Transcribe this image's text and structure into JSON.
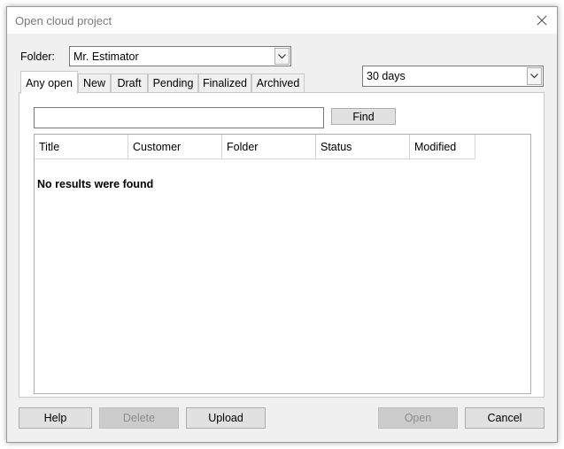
{
  "window": {
    "title": "Open cloud project"
  },
  "folder": {
    "label": "Folder:",
    "value": "Mr. Estimator"
  },
  "period": {
    "value": "30 days"
  },
  "tabs": [
    {
      "label": "Any open"
    },
    {
      "label": "New"
    },
    {
      "label": "Draft"
    },
    {
      "label": "Pending"
    },
    {
      "label": "Finalized"
    },
    {
      "label": "Archived"
    }
  ],
  "search": {
    "value": "",
    "placeholder": "",
    "find_label": "Find"
  },
  "table": {
    "columns": [
      "Title",
      "Customer",
      "Folder",
      "Status",
      "Modified"
    ],
    "empty_message": "No results were found"
  },
  "buttons": {
    "help": "Help",
    "delete": "Delete",
    "upload": "Upload",
    "open": "Open",
    "cancel": "Cancel"
  }
}
